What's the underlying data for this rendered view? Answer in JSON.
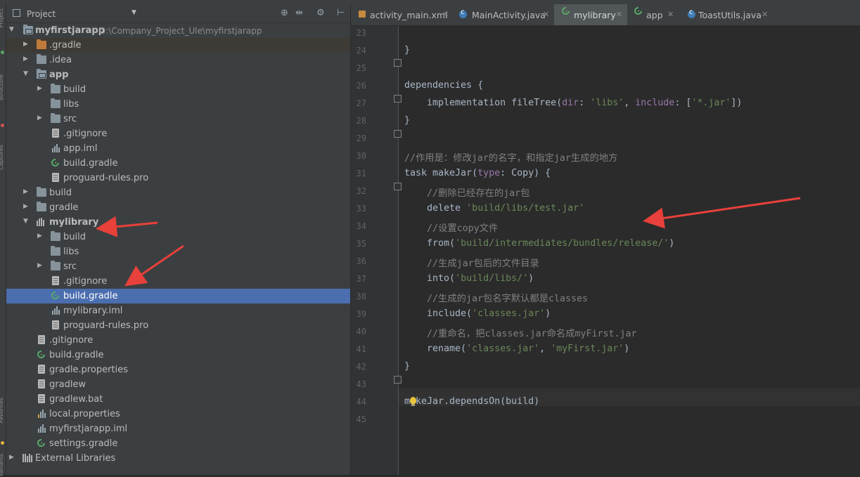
{
  "project_panel": {
    "header_label": "Project",
    "tools": [
      "⊕",
      "⇹",
      "⚙",
      "⊢"
    ]
  },
  "tree": [
    {
      "label": "myfirstjarapp",
      "path": "D:\\Company_Project_Ule\\myfirstjarapp"
    },
    {
      "label": ".gradle"
    },
    {
      "label": ".idea"
    },
    {
      "label": "app"
    },
    {
      "label": "build"
    },
    {
      "label": "libs"
    },
    {
      "label": "src"
    },
    {
      "label": ".gitignore"
    },
    {
      "label": "app.iml"
    },
    {
      "label": "build.gradle"
    },
    {
      "label": "proguard-rules.pro"
    },
    {
      "label": "build"
    },
    {
      "label": "gradle"
    },
    {
      "label": "mylibrary"
    },
    {
      "label": "build"
    },
    {
      "label": "libs"
    },
    {
      "label": "src"
    },
    {
      "label": ".gitignore"
    },
    {
      "label": "build.gradle"
    },
    {
      "label": "mylibrary.iml"
    },
    {
      "label": "proguard-rules.pro"
    },
    {
      "label": ".gitignore"
    },
    {
      "label": "build.gradle"
    },
    {
      "label": "gradle.properties"
    },
    {
      "label": "gradlew"
    },
    {
      "label": "gradlew.bat"
    },
    {
      "label": "local.properties"
    },
    {
      "label": "myfirstjarapp.iml"
    },
    {
      "label": "settings.gradle"
    },
    {
      "label": "External Libraries"
    }
  ],
  "tabs": [
    {
      "label": "activity_main.xml"
    },
    {
      "label": "MainActivity.java"
    },
    {
      "label": "mylibrary"
    },
    {
      "label": "app"
    },
    {
      "label": "ToastUtils.java"
    }
  ],
  "editor": {
    "line_numbers": [
      "23",
      "24",
      "25",
      "26",
      "27",
      "28",
      "29",
      "30",
      "31",
      "32",
      "33",
      "34",
      "35",
      "36",
      "37",
      "38",
      "39",
      "40",
      "41",
      "42",
      "43",
      "44",
      "45"
    ],
    "lines": [
      [],
      [
        {
          "t": "}"
        }
      ],
      [],
      [
        {
          "t": "dependencies {"
        }
      ],
      [
        {
          "t": "    implementation fileTree("
        },
        {
          "t": "dir",
          "c": "param"
        },
        {
          "t": ": "
        },
        {
          "t": "'libs'",
          "c": "str"
        },
        {
          "t": ", "
        },
        {
          "t": "include",
          "c": "param"
        },
        {
          "t": ": ["
        },
        {
          "t": "'*.jar'",
          "c": "str"
        },
        {
          "t": "])"
        }
      ],
      [
        {
          "t": "}"
        }
      ],
      [],
      [
        {
          "t": "//作用是：修改jar的名字，和指定jar生成的地方",
          "c": "cmt"
        }
      ],
      [
        {
          "t": "task makeJar("
        },
        {
          "t": "type",
          "c": "param"
        },
        {
          "t": ": Copy) {"
        }
      ],
      [
        {
          "t": "    "
        },
        {
          "t": "//删除已经存在的jar包",
          "c": "cmt"
        }
      ],
      [
        {
          "t": "    delete "
        },
        {
          "t": "'build/libs/test.jar'",
          "c": "str"
        }
      ],
      [
        {
          "t": "    "
        },
        {
          "t": "//设置copy文件",
          "c": "cmt"
        }
      ],
      [
        {
          "t": "    from("
        },
        {
          "t": "'build/intermediates/bundles/release/'",
          "c": "str"
        },
        {
          "t": ")"
        }
      ],
      [
        {
          "t": "    "
        },
        {
          "t": "//生成jar包后的文件目录",
          "c": "cmt"
        }
      ],
      [
        {
          "t": "    into("
        },
        {
          "t": "'build/libs/'",
          "c": "str"
        },
        {
          "t": ")"
        }
      ],
      [
        {
          "t": "    "
        },
        {
          "t": "//生成的jar包名字默认都是classes",
          "c": "cmt"
        }
      ],
      [
        {
          "t": "    include("
        },
        {
          "t": "'classes.jar'",
          "c": "str"
        },
        {
          "t": ")"
        }
      ],
      [
        {
          "t": "    "
        },
        {
          "t": "//重命名，把classes.jar命名成myFirst.jar",
          "c": "cmt"
        }
      ],
      [
        {
          "t": "    rename("
        },
        {
          "t": "'classes.jar'",
          "c": "str"
        },
        {
          "t": ", "
        },
        {
          "t": "'myFirst.jar'",
          "c": "str"
        },
        {
          "t": ")"
        }
      ],
      [
        {
          "t": "}"
        }
      ],
      [],
      [
        {
          "t": "makeJar.dependsOn(build)"
        }
      ],
      []
    ]
  },
  "colors": {
    "selection": "#4b6eaf",
    "annotation_arrow": "#e8403a",
    "string": "#6a8759",
    "comment": "#808080"
  }
}
